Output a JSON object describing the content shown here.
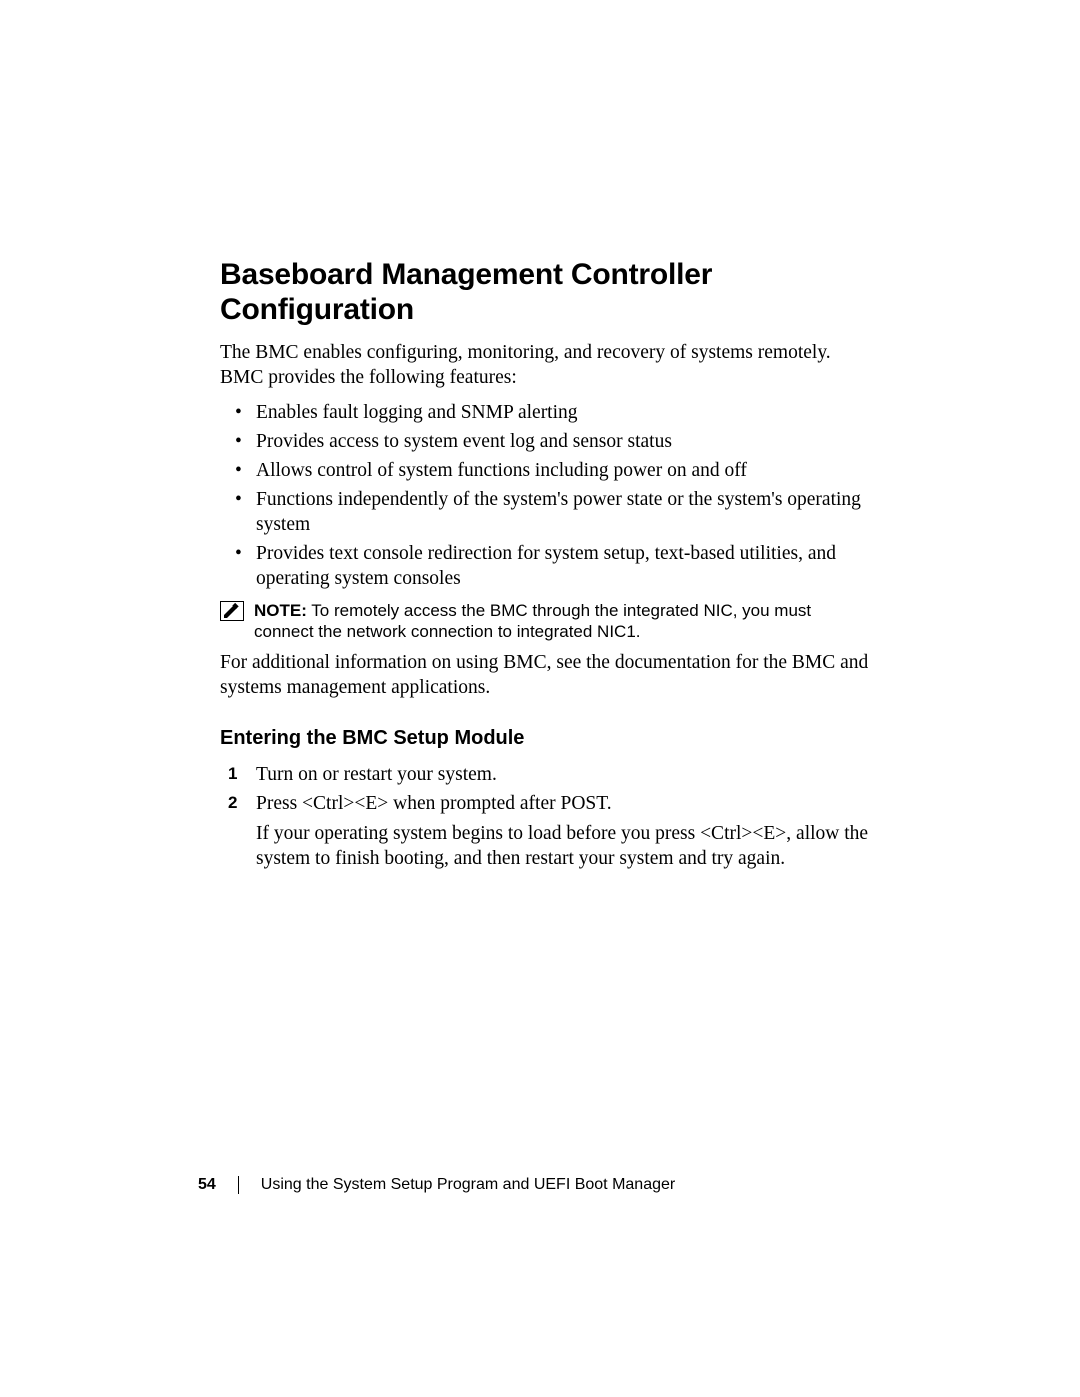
{
  "heading": "Baseboard Management Controller Configuration",
  "intro": "The BMC enables configuring, monitoring, and recovery of systems remotely. BMC provides the following features:",
  "bullets": [
    "Enables fault logging and SNMP alerting",
    "Provides access to system event log and sensor status",
    "Allows control of system functions including power on and off",
    "Functions independently of the system's power state or the system's operating system",
    "Provides text console redirection for system setup, text-based utilities, and operating system consoles"
  ],
  "note": {
    "label": "NOTE:",
    "text": " To remotely access the BMC through the integrated NIC, you must connect the network connection to integrated NIC1."
  },
  "para_after_note": "For additional information on using BMC, see the documentation for the BMC and systems management applications.",
  "subheading": "Entering the BMC Setup Module",
  "steps": [
    {
      "text": "Turn on or restart your system."
    },
    {
      "text": "Press <Ctrl><E> when prompted after POST.",
      "follow": "If your operating system begins to load before you press <Ctrl><E>, allow the system to finish booting, and then restart your system and try again."
    }
  ],
  "footer": {
    "page_num": "54",
    "title": "Using the System Setup Program and UEFI Boot Manager"
  }
}
